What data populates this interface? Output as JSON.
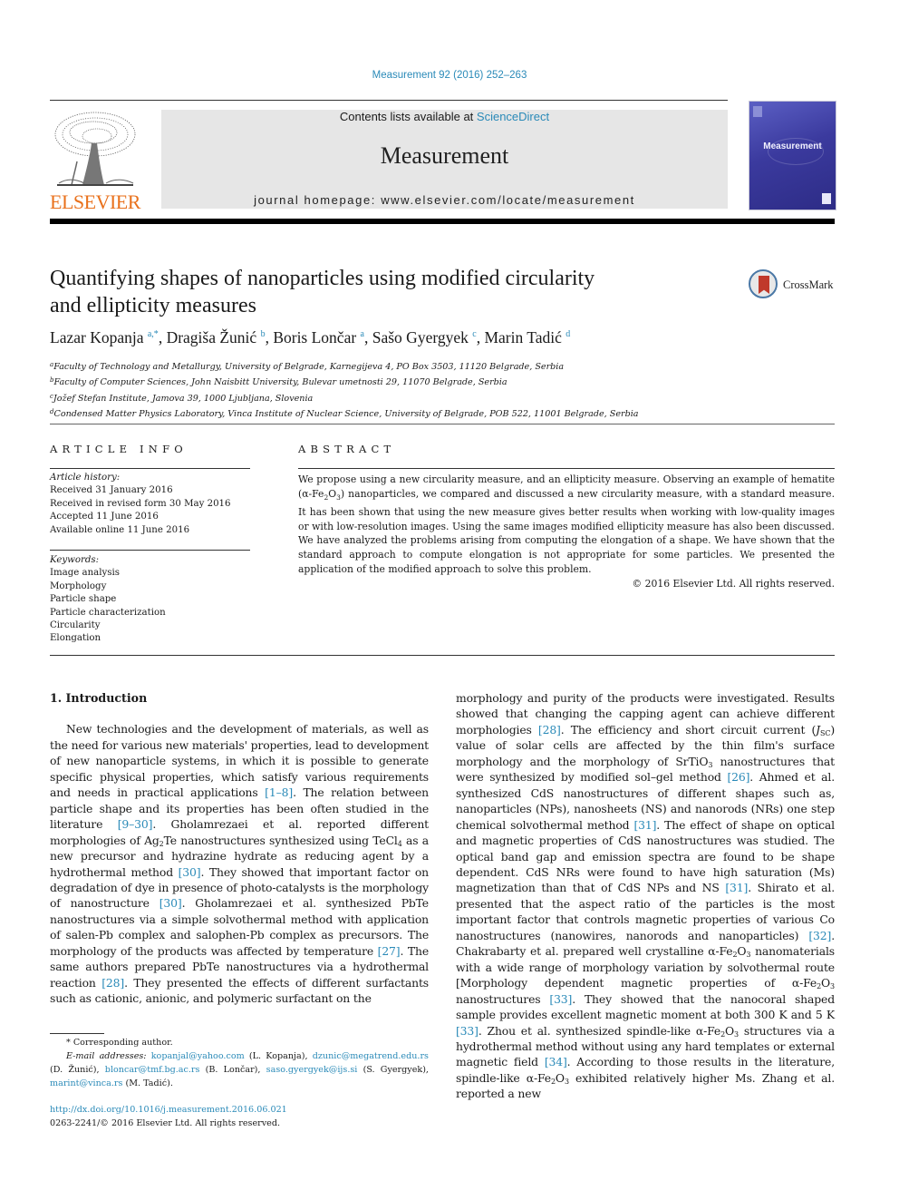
{
  "header": {
    "citation": "Measurement 92 (2016) 252–263",
    "contents_prefix": "Contents lists available at ",
    "contents_link": "ScienceDirect",
    "journal_title": "Measurement",
    "homepage": "journal homepage: www.elsevier.com/locate/measurement",
    "publisher_logo_text": "ELSEVIER",
    "cover_title": "Measurement",
    "crossmark_label": "CrossMark",
    "colors": {
      "link": "#2a8ab8",
      "elsevier_orange": "#e9711c",
      "masthead_bg": "#e6e6e6",
      "cover_blue": "#3b3a9e"
    }
  },
  "article": {
    "title_line1": "Quantifying shapes of nanoparticles using modified circularity",
    "title_line2": "and ellipticity measures",
    "authors": [
      {
        "name": "Lazar Kopanja",
        "aff": "a,*"
      },
      {
        "name": "Dragiša Žunić",
        "aff": "b"
      },
      {
        "name": "Boris Lončar",
        "aff": "a"
      },
      {
        "name": "Sašo Gyergyek",
        "aff": "c"
      },
      {
        "name": "Marin Tadić",
        "aff": "d"
      }
    ],
    "affiliations": [
      {
        "key": "a",
        "text": "Faculty of Technology and Metallurgy, University of Belgrade, Karnegijeva 4, PO Box 3503, 11120 Belgrade, Serbia"
      },
      {
        "key": "b",
        "text": "Faculty of Computer Sciences, John Naisbitt University, Bulevar umetnosti 29, 11070 Belgrade, Serbia"
      },
      {
        "key": "c",
        "text": "Jožef Stefan Institute, Jamova 39, 1000 Ljubljana, Slovenia"
      },
      {
        "key": "d",
        "text": "Condensed Matter Physics Laboratory, Vinca Institute of Nuclear Science, University of Belgrade, POB 522, 11001 Belgrade, Serbia"
      }
    ]
  },
  "article_info": {
    "heading": "ARTICLE INFO",
    "history_label": "Article history:",
    "history": [
      "Received 31 January 2016",
      "Received in revised form 30 May 2016",
      "Accepted 11 June 2016",
      "Available online 11 June 2016"
    ],
    "keywords_label": "Keywords:",
    "keywords": [
      "Image analysis",
      "Morphology",
      "Particle shape",
      "Particle characterization",
      "Circularity",
      "Elongation"
    ]
  },
  "abstract": {
    "heading": "ABSTRACT",
    "text_1": "We propose using a new circularity measure, and an ellipticity measure. Observing an example of hematite (α-Fe",
    "sub_1": "2",
    "text_2": "O",
    "sub_2": "3",
    "text_3": ") nanoparticles, we compared and discussed a new circularity measure, with a standard measure. It has been shown that using the new measure gives better results when working with low-quality images or with low-resolution images. Using the same images modified ellipticity measure has also been discussed. We have analyzed the problems arising from computing the elongation of a shape. We have shown that the standard approach to compute elongation is not appropriate for some particles. We presented the application of the modified approach to solve this problem.",
    "copyright": "© 2016 Elsevier Ltd. All rights reserved."
  },
  "intro": {
    "heading": "1. Introduction",
    "left": [
      {
        "t": "New technologies and the development of materials, as well as the need for various new materials' properties, lead to development of new nanoparticle systems, in which it is possible to generate specific physical properties, which satisfy various requirements and needs in practical applications "
      },
      {
        "ref": "[1–8]"
      },
      {
        "t": ". The relation between particle shape and its properties has been often studied in the literature "
      },
      {
        "ref": "[9–30]"
      },
      {
        "t": ". Gholamrezaei et al. reported different morphologies of Ag"
      },
      {
        "sub": "2"
      },
      {
        "t": "Te nanostructures synthesized using TeCl"
      },
      {
        "sub": "4"
      },
      {
        "t": " as a new precursor and hydrazine hydrate as reducing agent by a hydrothermal method "
      },
      {
        "ref": "[30]"
      },
      {
        "t": ". They showed that important factor on degradation of dye in presence of photo-catalysts is the morphology of nanostructure "
      },
      {
        "ref": "[30]"
      },
      {
        "t": ". Gholamrezaei et al. synthesized PbTe nanostructures via a simple solvothermal method with application of salen-Pb complex and salophen-Pb complex as precursors. The morphology of the products was affected by temperature "
      },
      {
        "ref": "[27]"
      },
      {
        "t": ". The same authors prepared PbTe nanostructures via a hydrothermal reaction "
      },
      {
        "ref": "[28]"
      },
      {
        "t": ". They presented the effects of different surfactants such as cationic, anionic, and polymeric surfactant on the"
      }
    ],
    "right": [
      {
        "t": "morphology and purity of the products were investigated. Results showed that changing the capping agent can achieve different morphologies "
      },
      {
        "ref": "[28]"
      },
      {
        "t": ". The efficiency and short circuit current ("
      },
      {
        "it": "J"
      },
      {
        "sub": "SC"
      },
      {
        "t": ") value of solar cells are affected by the thin film's surface morphology and the morphology of SrTiO"
      },
      {
        "sub": "3"
      },
      {
        "t": " nanostructures that were synthesized by modified sol–gel method "
      },
      {
        "ref": "[26]"
      },
      {
        "t": ". Ahmed et al. synthesized CdS nanostructures of different shapes such as, nanoparticles (NPs), nanosheets (NS) and nanorods (NRs) one step chemical solvothermal method "
      },
      {
        "ref": "[31]"
      },
      {
        "t": ". The effect of shape on optical and magnetic properties of CdS nanostructures was studied. The optical band gap and emission spectra are found to be shape dependent. CdS NRs were found to have high saturation (Ms) magnetization than that of CdS NPs and NS "
      },
      {
        "ref": "[31]"
      },
      {
        "t": ". Shirato et al. presented that the aspect ratio of the particles is the most important factor that controls magnetic properties of various Co nanostructures (nanowires, nanorods and nanoparticles) "
      },
      {
        "ref": "[32]"
      },
      {
        "t": ". Chakrabarty et al. prepared well crystalline α-Fe"
      },
      {
        "sub": "2"
      },
      {
        "t": "O"
      },
      {
        "sub": "3"
      },
      {
        "t": " nanomaterials with a wide range of morphology variation by solvothermal route [Morphology dependent magnetic properties of α-Fe"
      },
      {
        "sub": "2"
      },
      {
        "t": "O"
      },
      {
        "sub": "3"
      },
      {
        "t": " nanostructures "
      },
      {
        "ref": "[33]"
      },
      {
        "t": ". They showed that the nanocoral shaped sample provides excellent magnetic moment at both 300 K and 5 K "
      },
      {
        "ref": "[33]"
      },
      {
        "t": ". Zhou et al. synthesized spindle-like α-Fe"
      },
      {
        "sub": "2"
      },
      {
        "t": "O"
      },
      {
        "sub": "3"
      },
      {
        "t": " structures via a hydrothermal method without using any hard templates or external magnetic field "
      },
      {
        "ref": "[34]"
      },
      {
        "t": ". According to those results in the literature, spindle-like α-Fe"
      },
      {
        "sub": "2"
      },
      {
        "t": "O"
      },
      {
        "sub": "3"
      },
      {
        "t": " exhibited relatively higher Ms. Zhang et al. reported a new"
      }
    ]
  },
  "footnotes": {
    "corresponding": "* Corresponding author.",
    "email_label": "E-mail addresses:",
    "emails": [
      {
        "email": "kopanjal@yahoo.com",
        "who": " (L. Kopanja), "
      },
      {
        "email": "dzunic@megatrend.edu.rs",
        "who": " (D. Žunić), "
      },
      {
        "email": "bloncar@tmf.bg.ac.rs",
        "who": " (B. Lončar), "
      },
      {
        "email": "saso.gyergyek@ijs.si",
        "who": " (S. Gyergyek), "
      },
      {
        "email": "marint@vinca.rs",
        "who": " (M. Tadić)."
      }
    ],
    "doi": "http://dx.doi.org/10.1016/j.measurement.2016.06.021",
    "issn_line": "0263-2241/© 2016 Elsevier Ltd. All rights reserved."
  }
}
